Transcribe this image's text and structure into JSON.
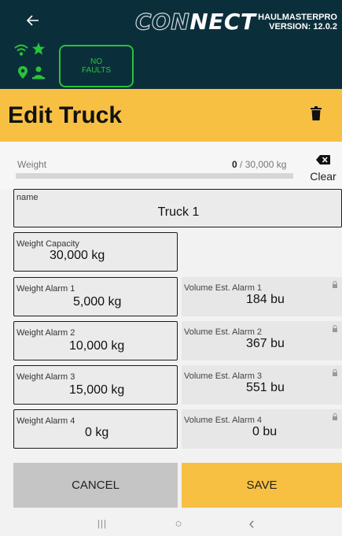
{
  "app": {
    "logo_text_con": "CON",
    "logo_text_nect": "NECT",
    "product": "HAULMASTERPRO",
    "version": "VERSION: 12.0.2"
  },
  "status": {
    "faults_line1": "NO",
    "faults_line2": "FAULTS",
    "color": "#29c23a"
  },
  "header": {
    "title": "Edit Truck"
  },
  "weight": {
    "label": "Weight",
    "current": "0",
    "separator": " / ",
    "capacity": "30,000 kg",
    "progress_fraction": 0,
    "clear_label": "Clear"
  },
  "form": {
    "name_label": "name",
    "name_value": "Truck 1",
    "capacity_label": "Weight Capacity",
    "capacity_value": "30,000 kg",
    "alarms": [
      {
        "label": "Weight Alarm 1",
        "value": "5,000 kg",
        "vol_label": "Volume Est. Alarm 1",
        "vol_value": "184 bu"
      },
      {
        "label": "Weight Alarm 2",
        "value": "10,000 kg",
        "vol_label": "Volume Est. Alarm 2",
        "vol_value": "367 bu"
      },
      {
        "label": "Weight Alarm 3",
        "value": "15,000 kg",
        "vol_label": "Volume Est. Alarm 3",
        "vol_value": "551 bu"
      },
      {
        "label": "Weight Alarm 4",
        "value": "0 kg",
        "vol_label": "Volume Est. Alarm 4",
        "vol_value": "0 bu"
      }
    ]
  },
  "actions": {
    "cancel": "CANCEL",
    "save": "SAVE"
  },
  "nav": {
    "recents": "|||",
    "home": "○",
    "back": "‹"
  },
  "colors": {
    "topbar": "#0b2f3a",
    "accent": "#f8c043",
    "status_green": "#29c23a"
  }
}
